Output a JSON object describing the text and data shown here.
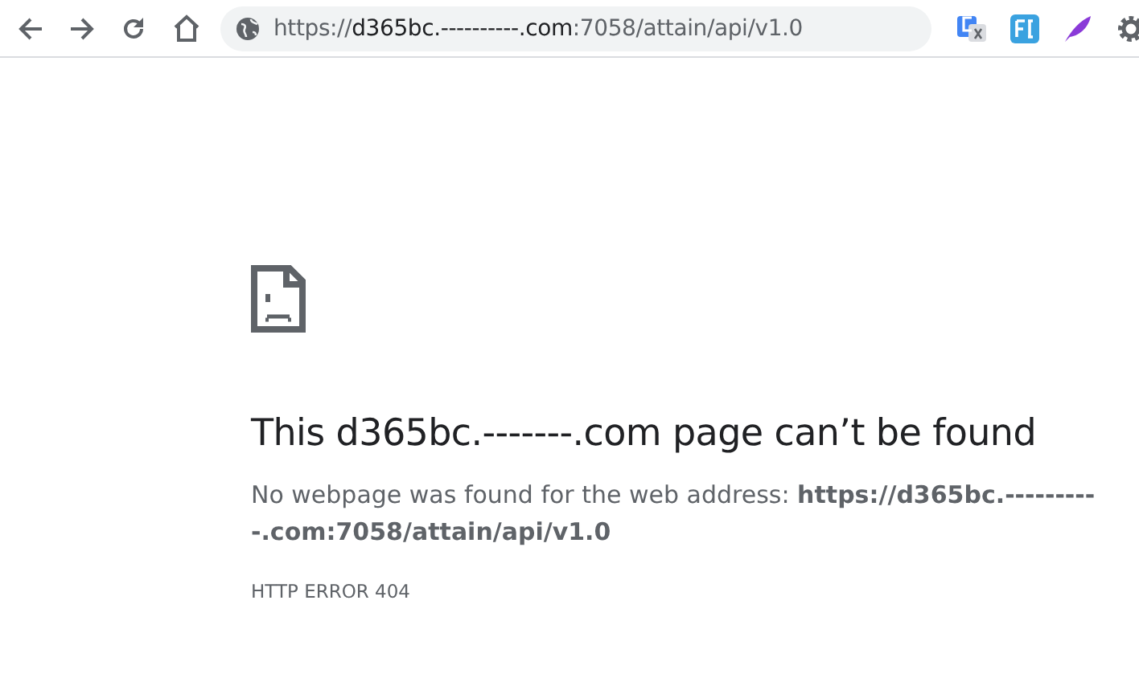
{
  "address_bar": {
    "scheme": "https://",
    "host": "d365bc.----------.com",
    "path": ":7058/attain/api/v1.0"
  },
  "error": {
    "heading": "This d365bc.-------.com page can’t be found",
    "description": "No webpage was found for the web address: **https://d365bc.----------.com:7058/attain/api/v1.0**",
    "code": "HTTP ERROR 404"
  }
}
